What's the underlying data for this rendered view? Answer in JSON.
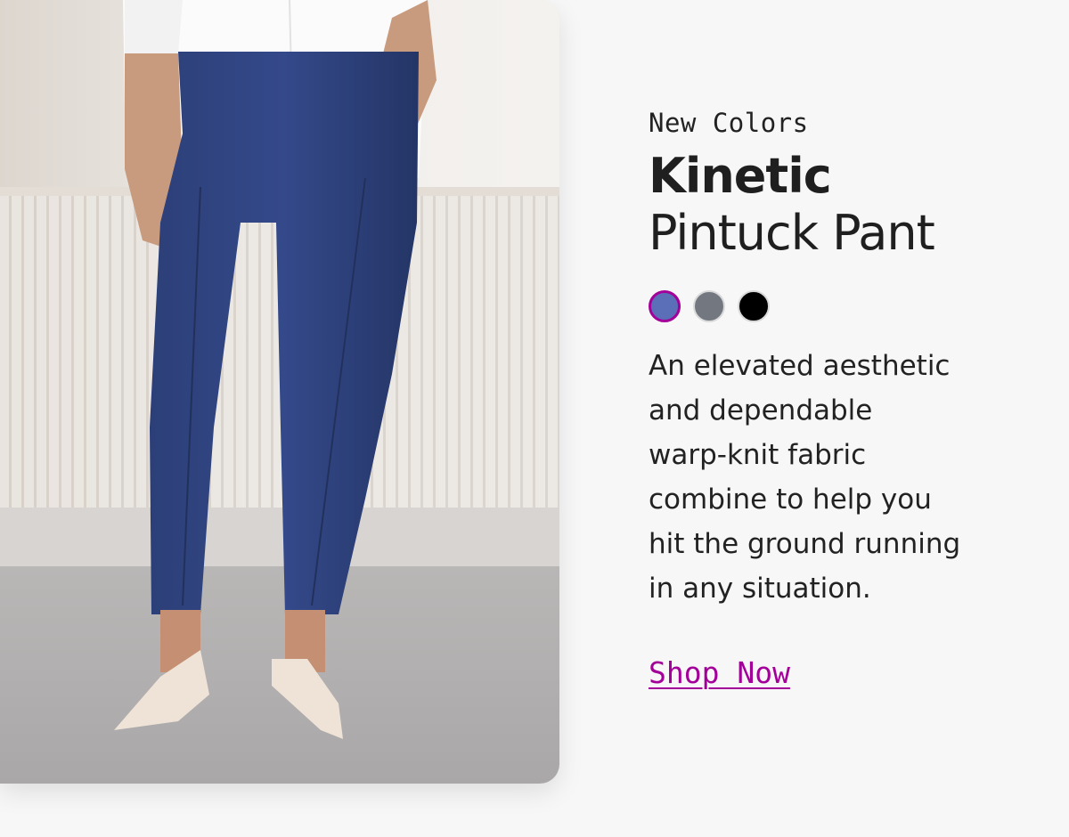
{
  "hero_image": {
    "subject": "Woman wearing navy pintuck pants, white shirt and nude flats"
  },
  "product": {
    "eyebrow": "New Colors",
    "name_bold": "Kinetic",
    "name_light": "Pintuck Pant",
    "colors": [
      {
        "name": "navy-blue",
        "hex": "#5b6eb8",
        "selected": true
      },
      {
        "name": "gray",
        "hex": "#727780",
        "selected": false
      },
      {
        "name": "black",
        "hex": "#000000",
        "selected": false
      }
    ],
    "description_lines": [
      "An elevated aesthetic",
      "and dependable",
      "warp-knit fabric",
      "combine to help you",
      "hit the ground running",
      "in any situation."
    ],
    "cta_label": "Shop Now"
  },
  "colors": {
    "accent": "#a3009a",
    "background": "#f7f7f7",
    "text": "#222222"
  }
}
